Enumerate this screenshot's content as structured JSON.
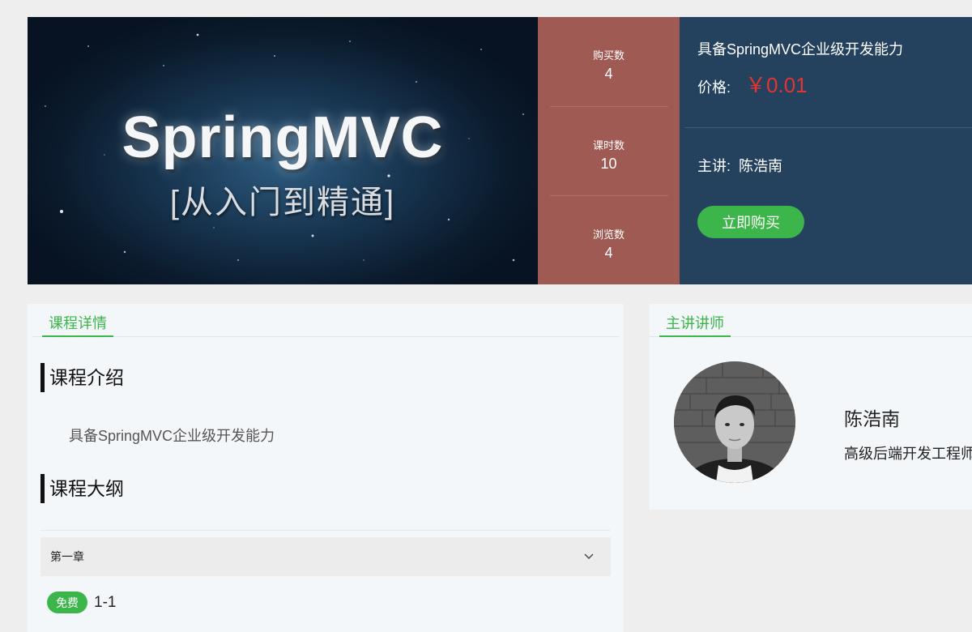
{
  "course": {
    "cover_title": "SpringMVC",
    "cover_subtitle": "[从入门到精通]",
    "title": "具备SpringMVC企业级开发能力",
    "price_label": "价格:",
    "price": "￥0.01",
    "teacher_label": "主讲:",
    "teacher_name": "陈浩南",
    "buy_label": "立即购买"
  },
  "stats": [
    {
      "label": "购买数",
      "value": "4"
    },
    {
      "label": "课时数",
      "value": "10"
    },
    {
      "label": "浏览数",
      "value": "4"
    }
  ],
  "details": {
    "tab_label": "课程详情",
    "intro_heading": "课程介绍",
    "intro_text": "具备SpringMVC企业级开发能力",
    "outline_heading": "课程大纲",
    "chapter_title": "第一章",
    "lesson_badge": "免费",
    "lesson_title": "1-1"
  },
  "instructor": {
    "tab_label": "主讲讲师",
    "name": "陈浩南",
    "title": "高级后端开发工程师"
  },
  "colors": {
    "accent_green": "#3cb54a",
    "stats_bg": "#a05a54",
    "info_bg": "#24415e",
    "price_red": "#e43333"
  },
  "icons": {
    "chapter_toggle": "chevron-down-icon"
  }
}
